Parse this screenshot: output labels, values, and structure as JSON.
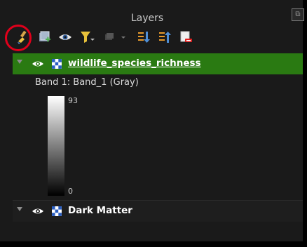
{
  "panel": {
    "title": "Layers",
    "float_button_glyph": "⧉"
  },
  "toolbar": {
    "items": [
      {
        "name": "style-layer-button",
        "icon": "paintbrush-icon"
      },
      {
        "name": "add-group-button",
        "icon": "add-group-icon"
      },
      {
        "name": "manage-visibility-button",
        "icon": "eye-icon"
      },
      {
        "name": "filter-legend-button",
        "icon": "filter-icon"
      },
      {
        "name": "filter-expression-button",
        "icon": "filter-expression-icon"
      },
      {
        "name": "expand-all-button",
        "icon": "expand-all-icon"
      },
      {
        "name": "collapse-all-button",
        "icon": "collapse-all-icon"
      },
      {
        "name": "remove-layer-button",
        "icon": "remove-layer-icon"
      }
    ],
    "highlight_color": "#e0001b"
  },
  "layers": [
    {
      "name": "wildlife_species_richness",
      "selected": true,
      "band_label": "Band 1: Band_1 (Gray)",
      "ramp_max": "93",
      "ramp_min": "0"
    },
    {
      "name": "Dark Matter",
      "selected": false
    }
  ],
  "colors": {
    "selection": "#2a7a12",
    "background": "#1a1a1a"
  }
}
